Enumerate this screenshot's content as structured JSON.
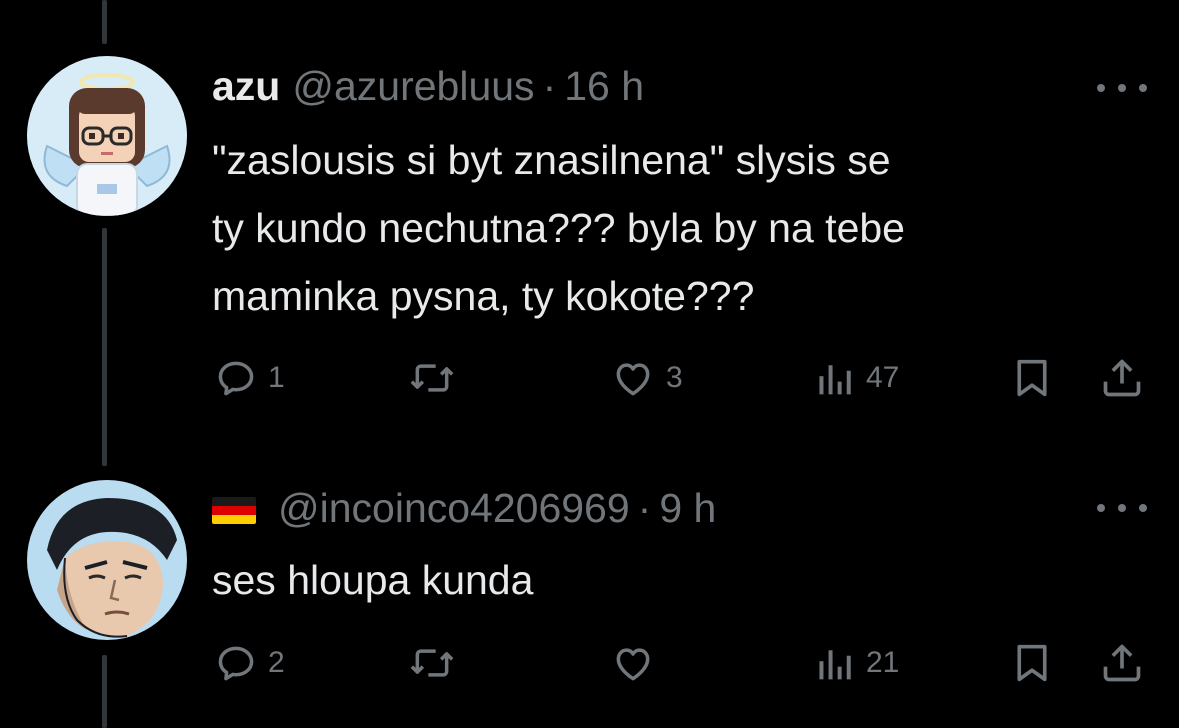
{
  "colors": {
    "background": "#000000",
    "text_primary": "#e7e9ea",
    "text_secondary": "#71767b",
    "thread_line": "#333639"
  },
  "tweets": [
    {
      "display_name": "azu",
      "handle": "@azurebluus",
      "separator": "·",
      "time": "16 h",
      "text_lines": [
        "\"zaslousis si byt znasilnena\" slysis se",
        "ty kundo nechutna??? byla by na tebe",
        "maminka pysna, ty kokote???"
      ],
      "avatar": "pixel-art-girl-with-glasses-avatar",
      "actions": {
        "reply": "1",
        "retweet": "",
        "like": "3",
        "views": "47"
      }
    },
    {
      "display_name": "",
      "flag": "german-flag-icon",
      "handle": "@incoinco4206969",
      "separator": "·",
      "time": "9 h",
      "text_lines": [
        "ses hloupa kunda"
      ],
      "avatar": "comic-man-portrait-avatar",
      "actions": {
        "reply": "2",
        "retweet": "",
        "like": "",
        "views": "21"
      }
    }
  ],
  "icons": {
    "more": "more-horizontal-icon",
    "reply": "reply-icon",
    "retweet": "retweet-icon",
    "like": "heart-icon",
    "views": "views-chart-icon",
    "bookmark": "bookmark-icon",
    "share": "share-icon"
  }
}
